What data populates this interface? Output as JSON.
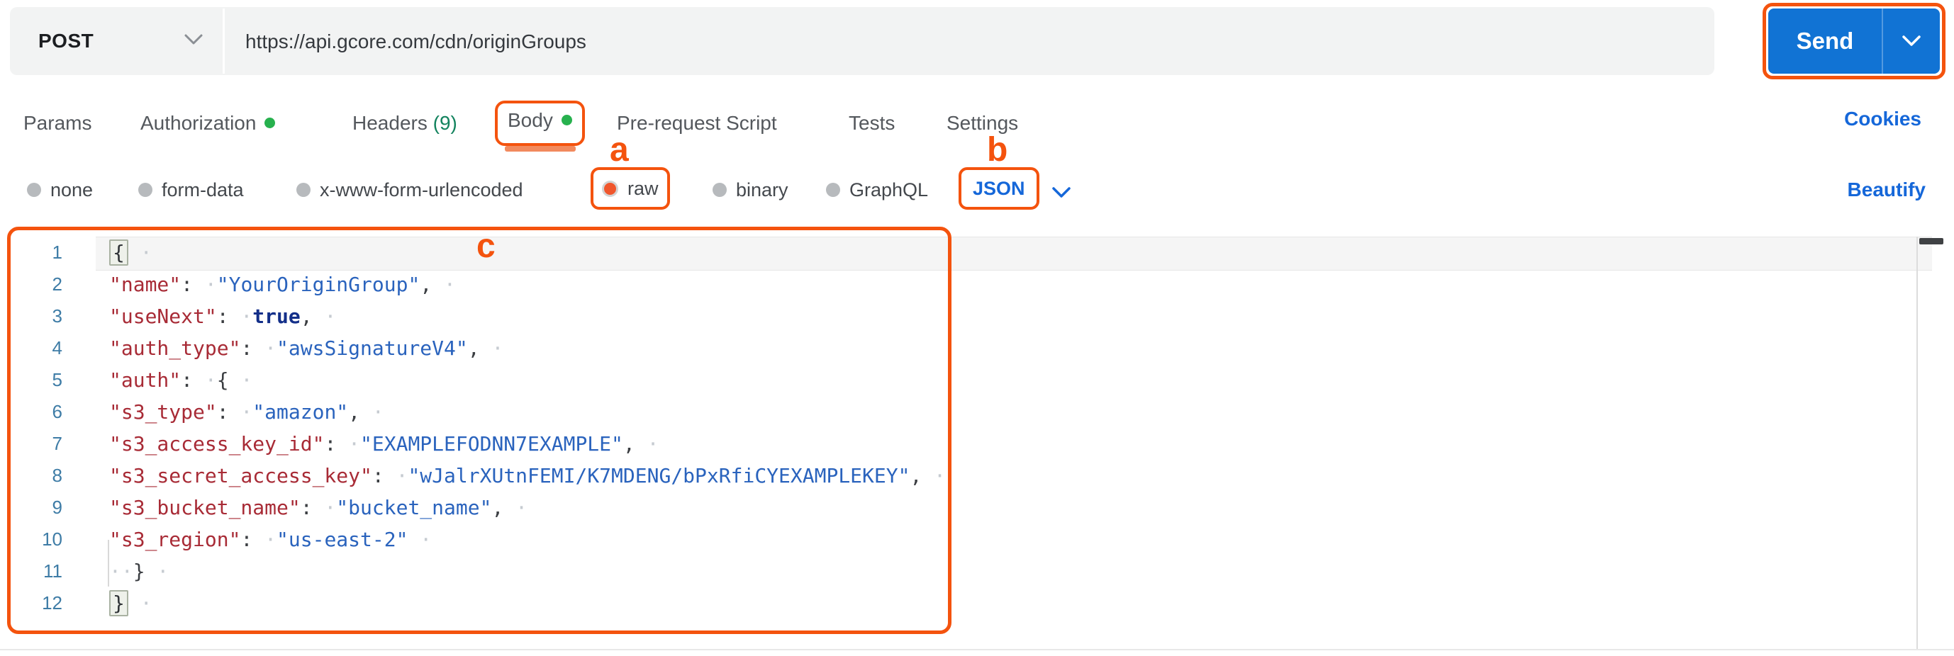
{
  "request_bar": {
    "method": "POST",
    "url": "https://api.gcore.com/cdn/originGroups",
    "send_label": "Send"
  },
  "tabs": {
    "items": [
      {
        "label": "Params"
      },
      {
        "label": "Authorization",
        "has_dot": true
      },
      {
        "label": "Headers",
        "count": "(9)"
      },
      {
        "label": "Body",
        "has_dot": true,
        "active": true
      },
      {
        "label": "Pre-request Script"
      },
      {
        "label": "Tests"
      },
      {
        "label": "Settings"
      }
    ],
    "cookies_link": "Cookies"
  },
  "body_options": {
    "radios": [
      {
        "label": "none",
        "selected": false
      },
      {
        "label": "form-data",
        "selected": false
      },
      {
        "label": "x-www-form-urlencoded",
        "selected": false
      },
      {
        "label": "raw",
        "selected": true
      },
      {
        "label": "binary",
        "selected": false
      },
      {
        "label": "GraphQL",
        "selected": false
      }
    ],
    "content_type": "JSON",
    "beautify_link": "Beautify"
  },
  "annotations": {
    "a": "a",
    "b": "b",
    "c": "c"
  },
  "colors": {
    "accent_orange": "#f4530e",
    "link_blue": "#1567d9",
    "send_blue": "#1173d4",
    "dot_green": "#27b14e",
    "count_green": "#13835e"
  },
  "editor": {
    "lines": [
      {
        "n": "1",
        "tokens": [
          {
            "t": "brkt",
            "v": "{"
          },
          {
            "t": "ws",
            "v": " ·"
          }
        ]
      },
      {
        "n": "2",
        "tokens": [
          {
            "t": "key",
            "v": "\"name\""
          },
          {
            "t": "punc",
            "v": ":"
          },
          {
            "t": "ws",
            "v": " ·"
          },
          {
            "t": "str",
            "v": "\"YourOriginGroup\""
          },
          {
            "t": "punc",
            "v": ","
          },
          {
            "t": "ws",
            "v": " ·"
          }
        ]
      },
      {
        "n": "3",
        "tokens": [
          {
            "t": "key",
            "v": "\"useNext\""
          },
          {
            "t": "punc",
            "v": ":"
          },
          {
            "t": "ws",
            "v": " ·"
          },
          {
            "t": "bool",
            "v": "true"
          },
          {
            "t": "punc",
            "v": ","
          },
          {
            "t": "ws",
            "v": " ·"
          }
        ]
      },
      {
        "n": "4",
        "tokens": [
          {
            "t": "key",
            "v": "\"auth_type\""
          },
          {
            "t": "punc",
            "v": ":"
          },
          {
            "t": "ws",
            "v": " ·"
          },
          {
            "t": "str",
            "v": "\"awsSignatureV4\""
          },
          {
            "t": "punc",
            "v": ","
          },
          {
            "t": "ws",
            "v": " ·"
          }
        ]
      },
      {
        "n": "5",
        "tokens": [
          {
            "t": "key",
            "v": "\"auth\""
          },
          {
            "t": "punc",
            "v": ":"
          },
          {
            "t": "ws",
            "v": " ·"
          },
          {
            "t": "punc",
            "v": "{"
          },
          {
            "t": "ws",
            "v": " ·"
          }
        ]
      },
      {
        "n": "6",
        "tokens": [
          {
            "t": "key",
            "v": "\"s3_type\""
          },
          {
            "t": "punc",
            "v": ":"
          },
          {
            "t": "ws",
            "v": " ·"
          },
          {
            "t": "str",
            "v": "\"amazon\""
          },
          {
            "t": "punc",
            "v": ","
          },
          {
            "t": "ws",
            "v": " ·"
          }
        ]
      },
      {
        "n": "7",
        "tokens": [
          {
            "t": "key",
            "v": "\"s3_access_key_id\""
          },
          {
            "t": "punc",
            "v": ":"
          },
          {
            "t": "ws",
            "v": " ·"
          },
          {
            "t": "str",
            "v": "\"EXAMPLEFODNN7EXAMPLE\""
          },
          {
            "t": "punc",
            "v": ","
          },
          {
            "t": "ws",
            "v": " ·"
          }
        ]
      },
      {
        "n": "8",
        "tokens": [
          {
            "t": "key",
            "v": "\"s3_secret_access_key\""
          },
          {
            "t": "punc",
            "v": ":"
          },
          {
            "t": "ws",
            "v": " ·"
          },
          {
            "t": "str",
            "v": "\"wJalrXUtnFEMI/K7MDENG/bPxRfiCYEXAMPLEKEY\""
          },
          {
            "t": "punc",
            "v": ","
          },
          {
            "t": "ws",
            "v": " ·"
          }
        ]
      },
      {
        "n": "9",
        "tokens": [
          {
            "t": "key",
            "v": "\"s3_bucket_name\""
          },
          {
            "t": "punc",
            "v": ":"
          },
          {
            "t": "ws",
            "v": " ·"
          },
          {
            "t": "str",
            "v": "\"bucket_name\""
          },
          {
            "t": "punc",
            "v": ","
          },
          {
            "t": "ws",
            "v": " ·"
          }
        ]
      },
      {
        "n": "10",
        "tokens": [
          {
            "t": "key",
            "v": "\"s3_region\""
          },
          {
            "t": "punc",
            "v": ":"
          },
          {
            "t": "ws",
            "v": " ·"
          },
          {
            "t": "str",
            "v": "\"us-east-2\""
          },
          {
            "t": "ws",
            "v": " ·"
          }
        ]
      },
      {
        "n": "11",
        "tokens": [
          {
            "t": "ws",
            "v": "··"
          },
          {
            "t": "punc",
            "v": "}"
          },
          {
            "t": "ws",
            "v": " ·"
          }
        ]
      },
      {
        "n": "12",
        "tokens": [
          {
            "t": "brkt",
            "v": "}"
          },
          {
            "t": "ws",
            "v": " ·"
          }
        ]
      }
    ]
  }
}
